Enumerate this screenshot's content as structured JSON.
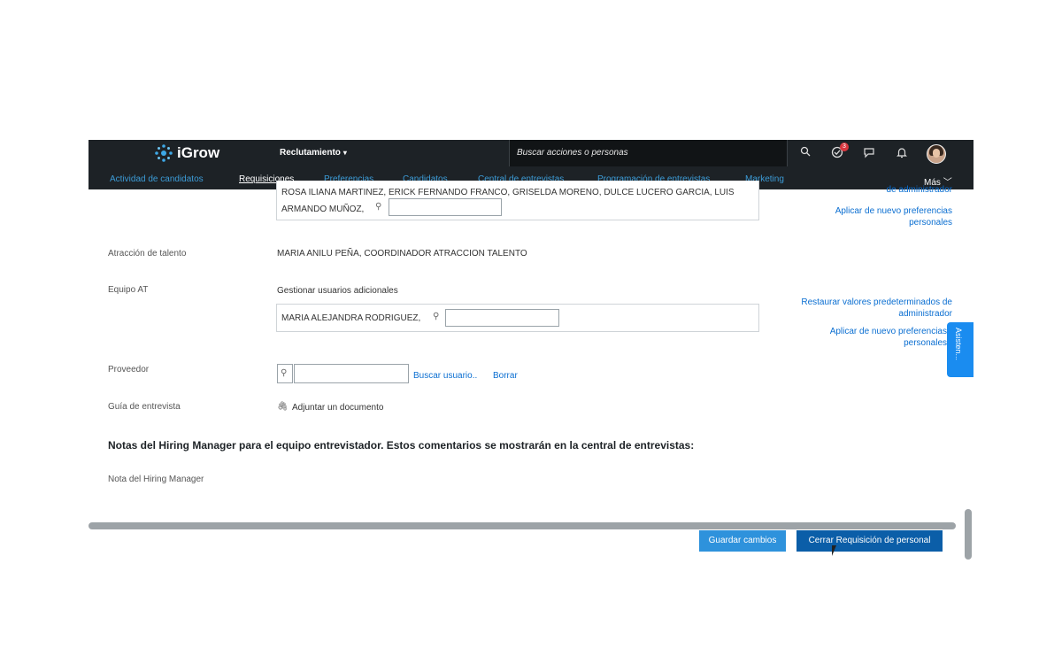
{
  "topbar": {
    "logo_text": "iGrow",
    "module": "Reclutamiento",
    "search_placeholder": "Buscar acciones o personas",
    "notification_count": "3"
  },
  "nav": {
    "items": [
      "Actividad de candidatos",
      "Requisiciones",
      "Preferencias",
      "Candidatos",
      "Central de entrevistas",
      "Programación de entrevistas",
      "Marketing"
    ],
    "more": "Más"
  },
  "form": {
    "top_names_line1": "ROSA ILIANA MARTINEZ, ERICK FERNANDO FRANCO, GRISELDA MORENO, DULCE LUCERO GARCIA, LUIS",
    "top_names_line2": "ARMANDO MUÑOZ,",
    "top_right_partial": "de administrador",
    "top_right_reapply": "Aplicar de nuevo preferencias personales",
    "atraccion_label": "Atracción de talento",
    "atraccion_value": "MARIA ANILU PEÑA, COORDINADOR ATRACCION TALENTO",
    "equipo_label": "Equipo AT",
    "equipo_manage": "Gestionar usuarios adicionales",
    "equipo_chip": "MARIA ALEJANDRA RODRIGUEZ,",
    "equipo_restore": "Restaurar valores predeterminados de administrador",
    "equipo_reapply": "Aplicar de nuevo preferencias personales",
    "proveedor_label": "Proveedor",
    "buscar_usuario": "Buscar usuario..",
    "borrar": "Borrar",
    "guia_label": "Guía de entrevista",
    "adjuntar": "Adjuntar un documento",
    "notas_heading": "Notas del Hiring Manager para el equipo entrevistador. Estos comentarios se mostrarán en la central de entrevistas:",
    "nota_label": "Nota del Hiring Manager"
  },
  "assistant_tab": "Asisten...",
  "buttons": {
    "save": "Guardar cambios",
    "close": "Cerrar Requisición de personal"
  }
}
